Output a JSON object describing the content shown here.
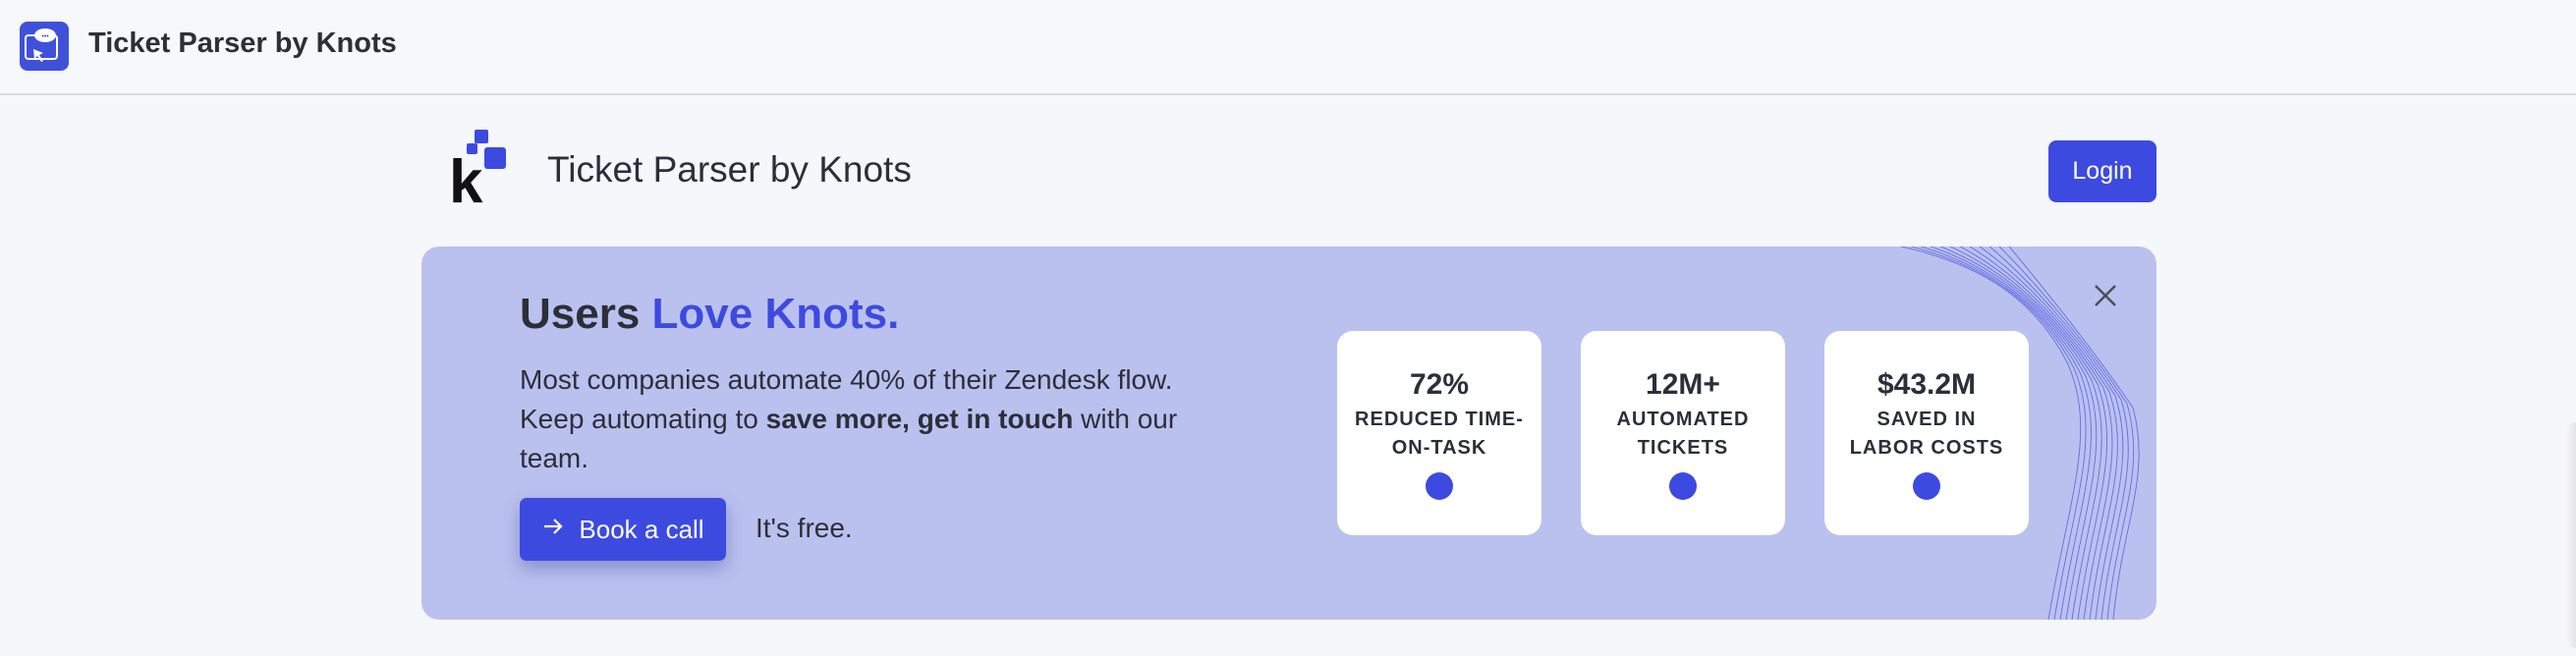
{
  "topbar": {
    "app_title": "Ticket Parser by Knots",
    "icon": "ticket-parser-app-icon"
  },
  "header": {
    "brand_title": "Ticket Parser by Knots",
    "login_label": "Login",
    "logo_letter": "k"
  },
  "banner": {
    "headline_part1": "Users ",
    "headline_accent": "Love Knots.",
    "desc_line1": "Most companies automate 40% of their Zendesk flow.",
    "desc_line2_pre": "Keep automating to ",
    "desc_line2_bold": "save more, get in touch",
    "desc_line2_post": " with our",
    "desc_line3": "team.",
    "book_label": "Book a call",
    "free_text": "It's free.",
    "stats": [
      {
        "value": "72%",
        "label": "Reduced time-on-task"
      },
      {
        "value": "12M+",
        "label": "Automated tickets"
      },
      {
        "value": "$43.2M",
        "label": "Saved in labor costs"
      }
    ]
  },
  "colors": {
    "accent": "#3d4ae0",
    "banner_bg": "#bbc1ee",
    "text": "#2b2f3a"
  }
}
